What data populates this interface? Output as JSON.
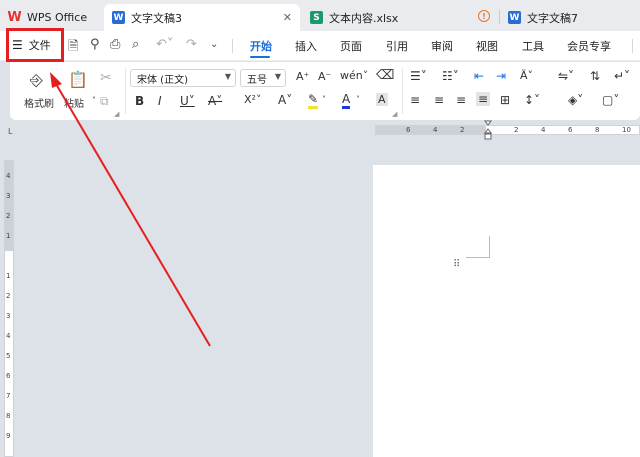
{
  "tabs": [
    {
      "label": "WPS Office"
    },
    {
      "label": "文字文稿3"
    },
    {
      "label": "文本内容.xlsx"
    },
    {
      "label": "文字文稿7"
    }
  ],
  "file_menu": {
    "label": "文件"
  },
  "menu": [
    "开始",
    "插入",
    "页面",
    "引用",
    "审阅",
    "视图",
    "工具",
    "会员专享"
  ],
  "ribbon": {
    "format_painter": "格式刷",
    "paste": "粘贴",
    "font_name": "宋体 (正文)",
    "font_size": "五号"
  },
  "hruler_marks": [
    "6",
    "4",
    "2",
    "2",
    "4",
    "6",
    "8",
    "10"
  ],
  "vruler_marks": [
    "4",
    "3",
    "2",
    "1",
    "1",
    "2",
    "3",
    "4",
    "5",
    "6",
    "7",
    "8",
    "9"
  ],
  "colors": {
    "accent": "#1a6fe0",
    "highlight": "#e41f1f"
  }
}
